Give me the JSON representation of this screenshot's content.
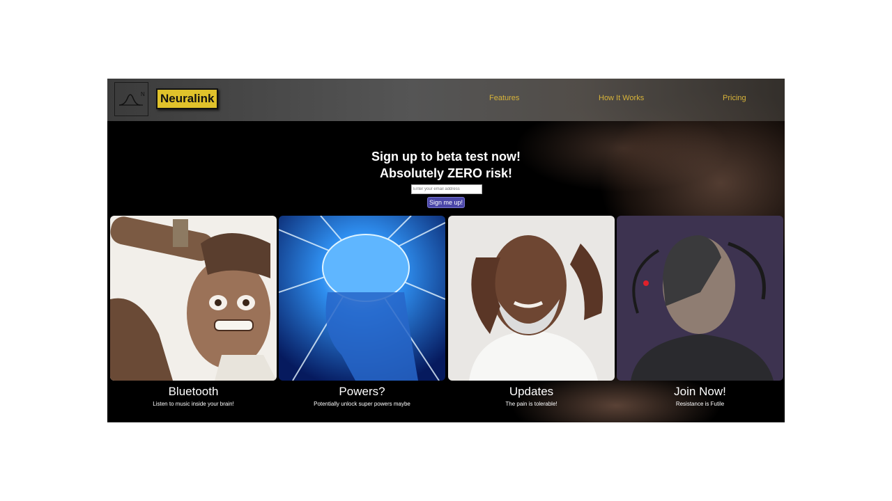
{
  "nav": {
    "brand": "Neuralink",
    "logo_letter": "N",
    "links": [
      "Features",
      "How It Works",
      "Pricing"
    ]
  },
  "hero": {
    "line1": "Sign up to beta test now!",
    "line2": "Absolutely ZERO risk!",
    "email_placeholder": "Enter your email address",
    "button_label": "Sign me up!"
  },
  "cards": [
    {
      "title": "Bluetooth",
      "subtitle": "Listen to music inside your brain!",
      "image": "panicked-man-photo"
    },
    {
      "title": "Powers?",
      "subtitle": "Potentially unlock super powers maybe",
      "image": "glowing-brain-photo"
    },
    {
      "title": "Updates",
      "subtitle": "The pain is tolerable!",
      "image": "headache-man-photo"
    },
    {
      "title": "Join Now!",
      "subtitle": "Resistance is Futile",
      "image": "cyborg-borg-photo"
    }
  ],
  "colors": {
    "brand_yellow": "#e0c22b",
    "nav_link": "#d8b43a",
    "button": "#4a46a8"
  }
}
